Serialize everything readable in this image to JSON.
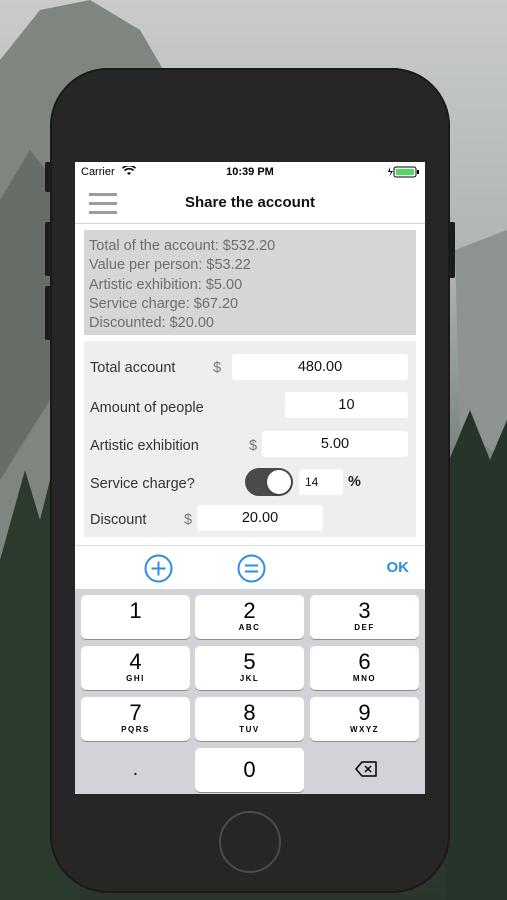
{
  "status_bar": {
    "carrier": "Carrier",
    "time": "10:39 PM"
  },
  "nav": {
    "title": "Share the account"
  },
  "summary": {
    "lines": [
      "Total of the account: $532.20",
      "Value per person: $53.22",
      "Artistic exhibition: $5.00",
      "Service charge: $67.20",
      "Discounted: $20.00"
    ]
  },
  "form": {
    "total_account": {
      "label": "Total account",
      "currency": "$",
      "value": "480.00"
    },
    "amount_people": {
      "label": "Amount of people",
      "value": "10"
    },
    "artistic_exhibition": {
      "label": "Artistic exhibition",
      "currency": "$",
      "value": "5.00"
    },
    "service_charge": {
      "label": "Service charge?",
      "enabled": true,
      "value": "14",
      "unit": "%"
    },
    "discount": {
      "label": "Discount",
      "currency": "$",
      "value": "20.00"
    }
  },
  "accessory": {
    "plus_icon": "plus-circle-icon",
    "equals_icon": "equals-circle-icon",
    "ok_label": "OK"
  },
  "keyboard": {
    "keys": [
      {
        "digit": "1",
        "letters": ""
      },
      {
        "digit": "2",
        "letters": "ABC"
      },
      {
        "digit": "3",
        "letters": "DEF"
      },
      {
        "digit": "4",
        "letters": "GHI"
      },
      {
        "digit": "5",
        "letters": "JKL"
      },
      {
        "digit": "6",
        "letters": "MNO"
      },
      {
        "digit": "7",
        "letters": "PQRS"
      },
      {
        "digit": "8",
        "letters": "TUV"
      },
      {
        "digit": "9",
        "letters": "WXYZ"
      }
    ],
    "decimal": ".",
    "zero": "0",
    "delete_icon": "backspace-icon"
  },
  "colors": {
    "accent": "#2e8fe0",
    "battery": "#4cd964",
    "toggle_on": "#4a4a4a"
  }
}
